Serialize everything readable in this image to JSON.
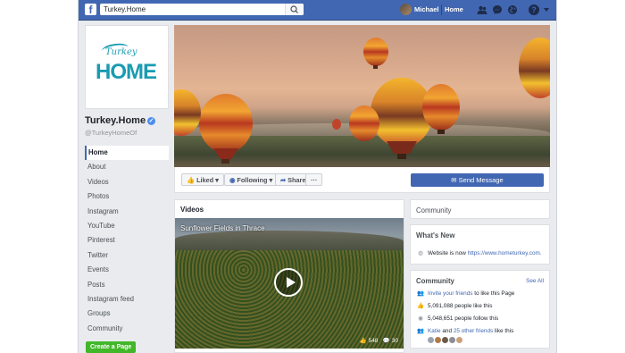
{
  "topbar": {
    "search_value": "Turkey.Home",
    "user_name": "Michael",
    "home_label": "Home"
  },
  "page": {
    "logo_script": "Turkey",
    "logo_word": "HOME",
    "name": "Turkey.Home",
    "handle": "@TurkeyHomeOf",
    "create_page": "Create a Page",
    "menu": [
      "Home",
      "About",
      "Videos",
      "Photos",
      "Instagram",
      "YouTube",
      "Pinterest",
      "Twitter",
      "Events",
      "Posts",
      "Instagram feed",
      "Groups",
      "Community"
    ]
  },
  "actions": {
    "liked": "Liked",
    "following": "Following",
    "share": "Share",
    "more": "···",
    "send_message": "Send Message"
  },
  "videos": {
    "heading": "Videos",
    "video_title": "Sunflower Fields in Thrace",
    "likes": "548",
    "comments": "30"
  },
  "community_tab": {
    "label": "Community"
  },
  "whats_new": {
    "title": "What's New",
    "text": "Website is now",
    "url": "https://www.hometurkey.com."
  },
  "community": {
    "title": "Community",
    "see_all": "See All",
    "invite_link": "Invite your friends",
    "invite_text": "to like this Page",
    "likes_text": "5,091,088 people like this",
    "follows_text": "5,048,651 people follow this",
    "friend_name": "Katie",
    "friends_and": "and",
    "friends_link": "25 other friends",
    "friends_text": "like this"
  },
  "colors": {
    "fb_blue": "#4267b2",
    "logo_teal": "#1a9bb1",
    "create_green": "#42b72a"
  }
}
